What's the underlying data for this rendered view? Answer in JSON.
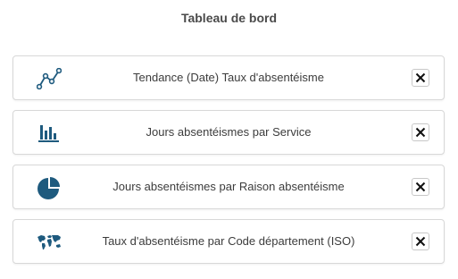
{
  "page": {
    "title": "Tableau de bord"
  },
  "colors": {
    "icon": "#1e5a7e",
    "border": "#d8d8d8",
    "text": "#3c3c3c"
  },
  "widgets": [
    {
      "label": "Tendance (Date) Taux d'absentéisme",
      "icon": "line-chart-icon"
    },
    {
      "label": "Jours absentéismes par Service",
      "icon": "bar-chart-icon"
    },
    {
      "label": "Jours absentéismes par Raison absentéisme",
      "icon": "pie-chart-icon"
    },
    {
      "label": "Taux d'absentéisme par Code département (ISO)",
      "icon": "world-map-icon"
    }
  ]
}
